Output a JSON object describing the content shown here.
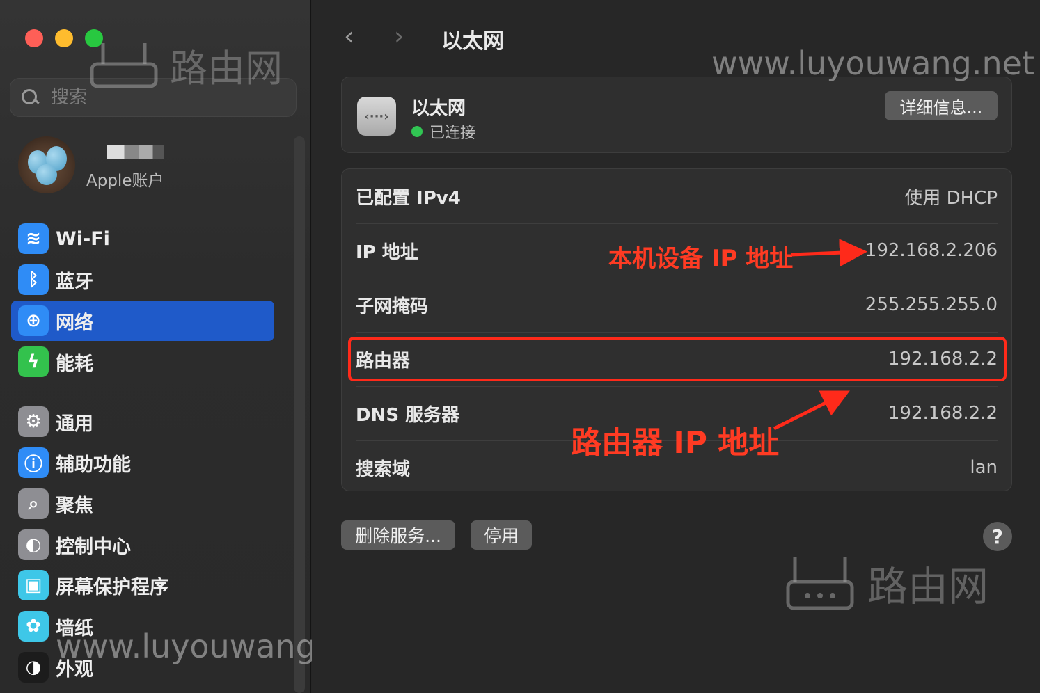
{
  "sidebar": {
    "search_placeholder": "搜索",
    "account_label": "Apple账户",
    "items": [
      {
        "label": "Wi-Fi",
        "icon": "wifi-icon",
        "color": "#2f8cf6"
      },
      {
        "label": "蓝牙",
        "icon": "bluetooth-icon",
        "color": "#2f8cf6"
      },
      {
        "label": "网络",
        "icon": "globe-icon",
        "color": "#2f8cf6"
      },
      {
        "label": "能耗",
        "icon": "battery-bolt-icon",
        "color": "#33c24d"
      },
      {
        "label": "通用",
        "icon": "gear-icon",
        "color": "#8e8e93"
      },
      {
        "label": "辅助功能",
        "icon": "accessibility-icon",
        "color": "#2f8cf6"
      },
      {
        "label": "聚焦",
        "icon": "magnifier-icon",
        "color": "#8e8e93"
      },
      {
        "label": "控制中心",
        "icon": "toggles-icon",
        "color": "#8e8e93"
      },
      {
        "label": "屏幕保护程序",
        "icon": "screensaver-icon",
        "color": "#3ec7e8"
      },
      {
        "label": "墙纸",
        "icon": "flower-icon",
        "color": "#3ec7e8"
      },
      {
        "label": "外观",
        "icon": "appearance-icon",
        "color": "#1c1c1c"
      }
    ]
  },
  "header": {
    "back": "‹",
    "forward": "›",
    "title": "以太网"
  },
  "service": {
    "name": "以太网",
    "status": "已连接",
    "details_button": "详细信息..."
  },
  "info_rows": [
    {
      "key": "已配置 IPv4",
      "value": "使用 DHCP"
    },
    {
      "key": "IP 地址",
      "value": "192.168.2.206"
    },
    {
      "key": "子网掩码",
      "value": "255.255.255.0"
    },
    {
      "key": "路由器",
      "value": "192.168.2.2"
    },
    {
      "key": "DNS 服务器",
      "value": "192.168.2.2"
    },
    {
      "key": "搜索域",
      "value": "lan"
    }
  ],
  "buttons": {
    "remove_service": "删除服务...",
    "disable": "停用",
    "help": "?"
  },
  "annotations": {
    "local_ip": "本机设备 IP 地址",
    "router_ip": "路由器 IP 地址"
  },
  "watermarks": {
    "url": "www.luyouwang.net",
    "logo_text": "路由网"
  },
  "colors": {
    "accent": "#1f5ac9",
    "annotation": "#ff2a1a",
    "connected": "#31c553"
  }
}
